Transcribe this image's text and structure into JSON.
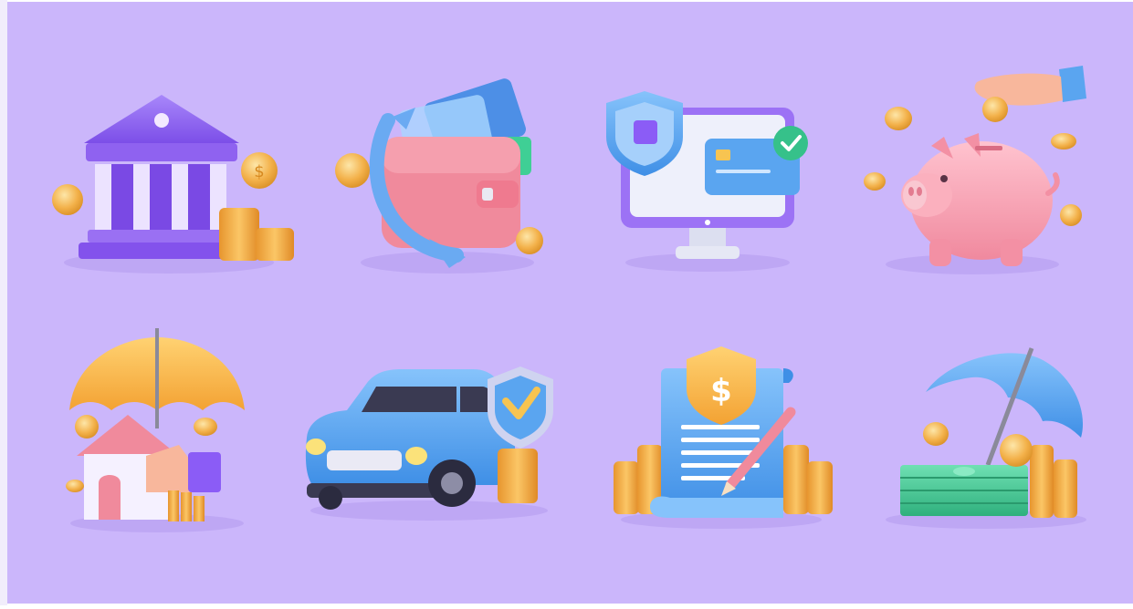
{
  "illustration": {
    "background_color": "#cbb6fb",
    "icons": [
      {
        "row": 1,
        "col": 1,
        "icon": "bank-building-icon"
      },
      {
        "row": 1,
        "col": 2,
        "icon": "wallet-with-cards-icon"
      },
      {
        "row": 1,
        "col": 3,
        "icon": "secure-payment-monitor-icon"
      },
      {
        "row": 1,
        "col": 4,
        "icon": "piggy-bank-icon"
      },
      {
        "row": 2,
        "col": 1,
        "icon": "home-insurance-umbrella-icon"
      },
      {
        "row": 2,
        "col": 2,
        "icon": "car-insurance-icon"
      },
      {
        "row": 2,
        "col": 3,
        "icon": "insurance-contract-icon"
      },
      {
        "row": 2,
        "col": 4,
        "icon": "money-protection-umbrella-icon"
      }
    ],
    "coin_symbol": "$",
    "colors": {
      "purple": "#8b5cf6",
      "pink": "#f08a9c",
      "blue": "#5aa5f0",
      "gold": "#f3b14a",
      "green": "#36c18a"
    }
  }
}
